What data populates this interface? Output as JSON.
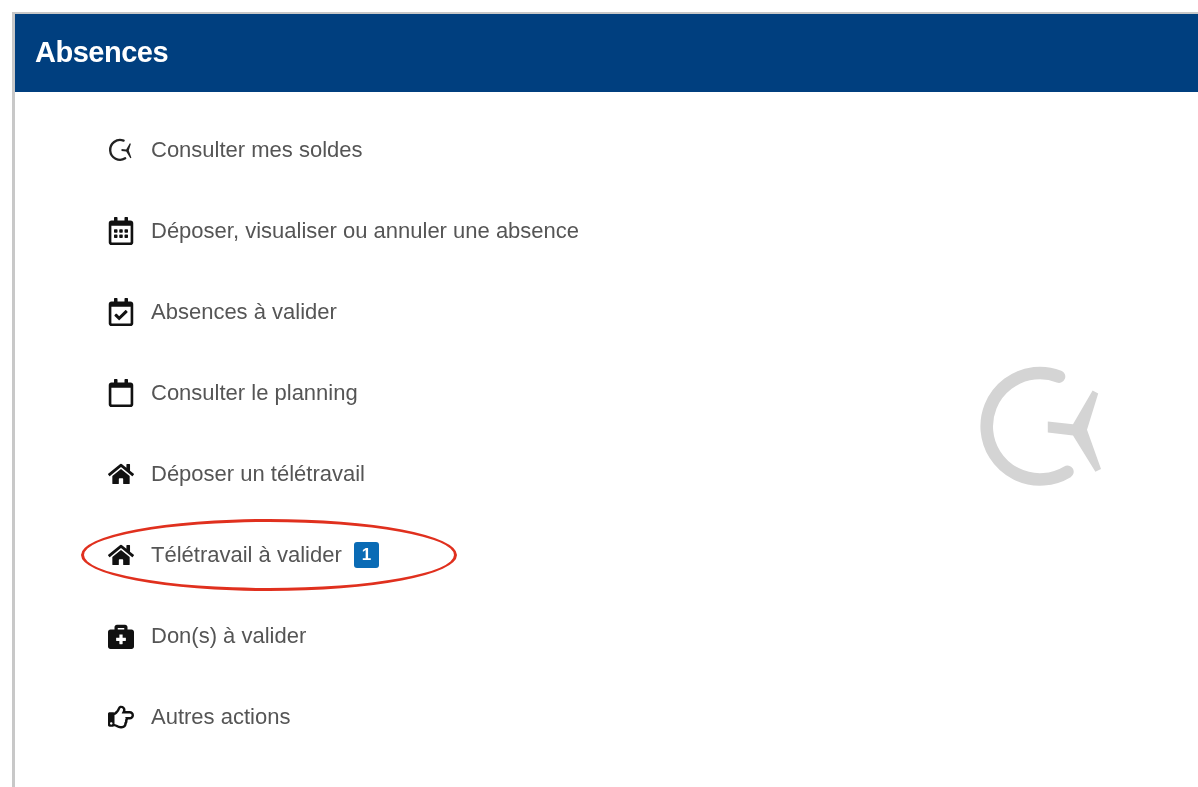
{
  "panel": {
    "title": "Absences"
  },
  "items": [
    {
      "label": "Consulter mes soldes",
      "highlighted": false
    },
    {
      "label": "Déposer, visualiser ou annuler une absence",
      "highlighted": false
    },
    {
      "label": "Absences à valider",
      "highlighted": false
    },
    {
      "label": "Consulter le planning",
      "highlighted": false
    },
    {
      "label": "Déposer un télétravail",
      "highlighted": false
    },
    {
      "label": "Télétravail à valider",
      "badge": "1",
      "highlighted": true
    },
    {
      "label": "Don(s) à valider",
      "highlighted": false
    },
    {
      "label": "Autres actions",
      "highlighted": false
    }
  ]
}
